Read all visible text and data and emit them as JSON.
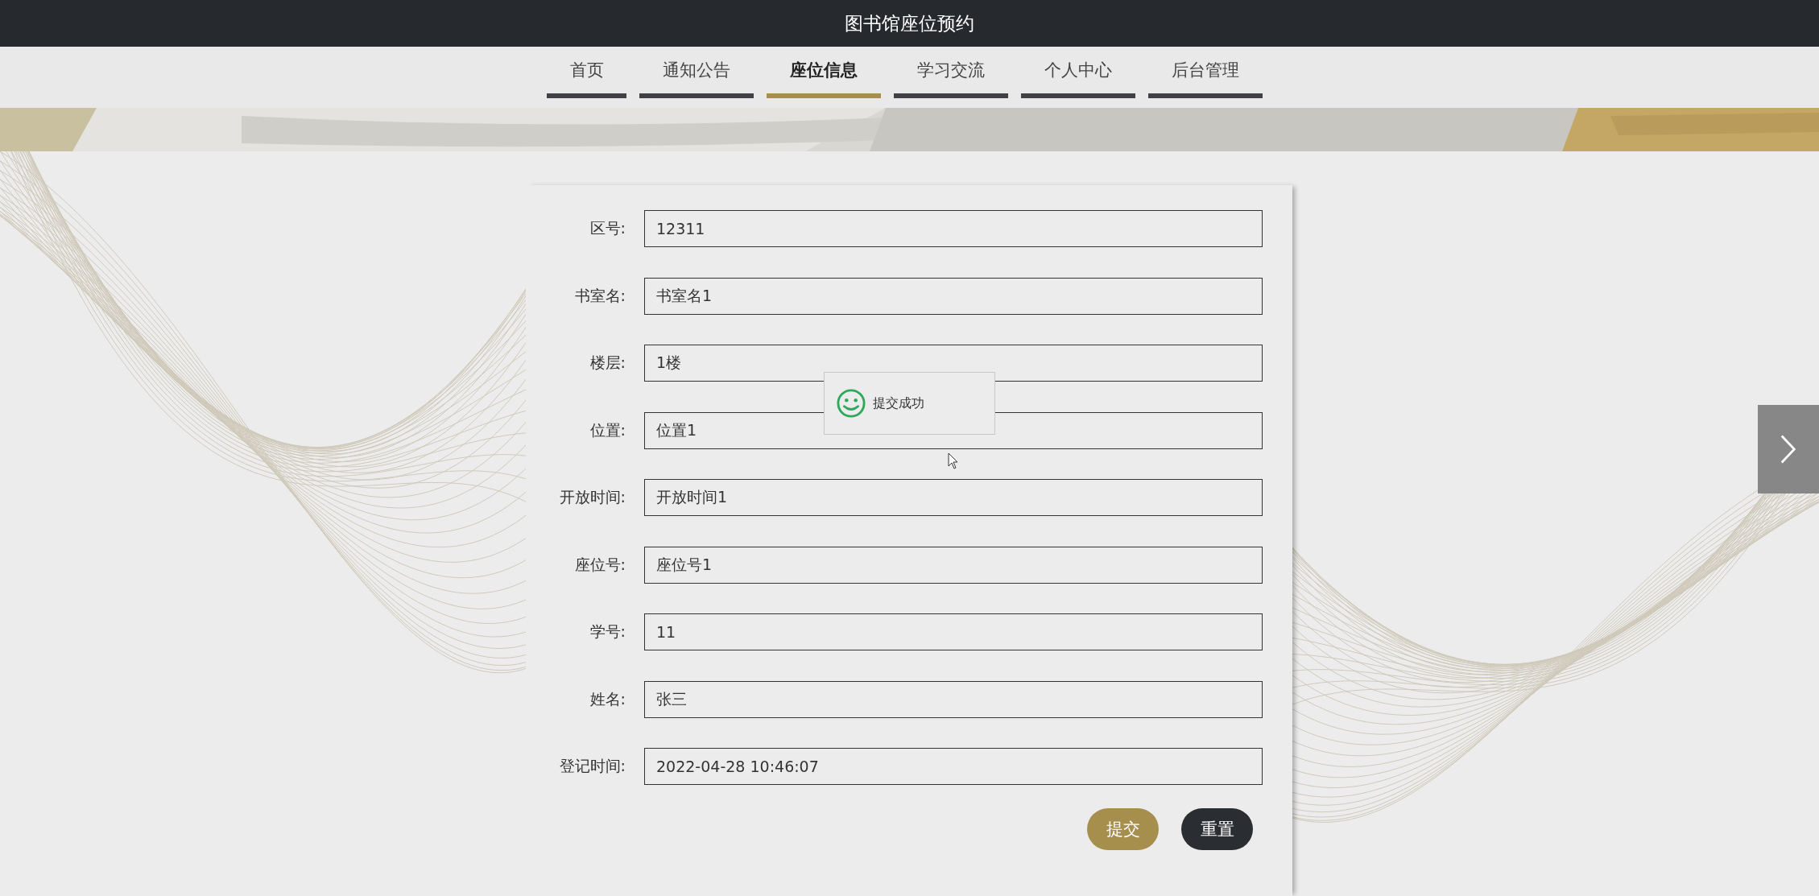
{
  "header": {
    "title": "图书馆座位预约"
  },
  "nav": [
    {
      "label": "首页",
      "selected": false
    },
    {
      "label": "通知公告",
      "selected": false
    },
    {
      "label": "座位信息",
      "selected": true
    },
    {
      "label": "学习交流",
      "selected": false
    },
    {
      "label": "个人中心",
      "selected": false
    },
    {
      "label": "后台管理",
      "selected": false
    }
  ],
  "form": {
    "fields": [
      {
        "label": "区号:",
        "value": "12311"
      },
      {
        "label": "书室名:",
        "value": "书室名1"
      },
      {
        "label": "楼层:",
        "value": "1楼"
      },
      {
        "label": "位置:",
        "value": "位置1"
      },
      {
        "label": "开放时间:",
        "value": "开放时间1"
      },
      {
        "label": "座位号:",
        "value": "座位号1"
      },
      {
        "label": "学号:",
        "value": "11"
      },
      {
        "label": "姓名:",
        "value": "张三"
      },
      {
        "label": "登记时间:",
        "value": "2022-04-28 10:46:07"
      }
    ],
    "buttons": [
      {
        "label": "提交",
        "kind": "primary"
      },
      {
        "label": "重置",
        "kind": "secondary"
      }
    ]
  },
  "toast": {
    "message": "提交成功"
  }
}
